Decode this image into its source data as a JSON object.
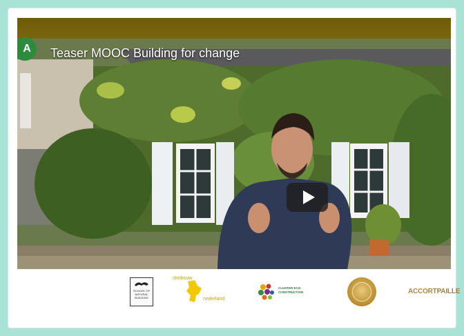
{
  "video": {
    "title": "Teaser MOOC Building for change",
    "channel_initial": "A",
    "colors": {
      "title_bar": "#6f5a0a",
      "avatar": "#2e8b3e",
      "page_background": "#a9e3d6"
    }
  },
  "logos": {
    "school": "SCHOOL OF NATURAL BUILDING",
    "strobouw_top": "strobouw",
    "strobouw_bottom": "nederland",
    "cluster": "CLUSTER ECO CONSTRUCTION",
    "accord_part1": "ACCORT",
    "accord_part2": "PAILLE"
  },
  "icons": [
    "play-icon",
    "channel-avatar-icon",
    "school-logo-icon",
    "strobouw-logo-icon",
    "cluster-logo-icon",
    "seal-logo-icon"
  ]
}
